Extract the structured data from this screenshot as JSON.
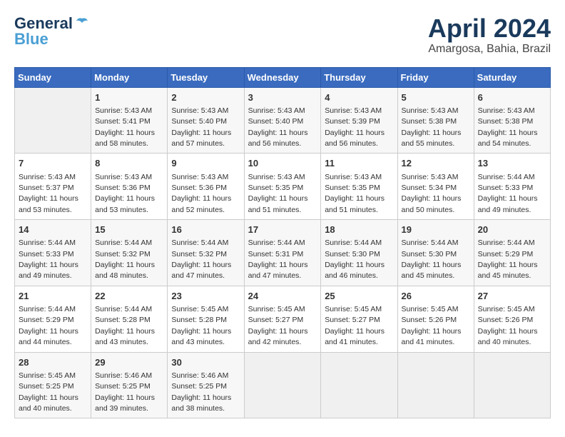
{
  "header": {
    "logo_line1": "General",
    "logo_line2": "Blue",
    "month": "April 2024",
    "location": "Amargosa, Bahia, Brazil"
  },
  "weekdays": [
    "Sunday",
    "Monday",
    "Tuesday",
    "Wednesday",
    "Thursday",
    "Friday",
    "Saturday"
  ],
  "weeks": [
    [
      {
        "day": "",
        "sunrise": "",
        "sunset": "",
        "daylight": ""
      },
      {
        "day": "1",
        "sunrise": "5:43 AM",
        "sunset": "5:41 PM",
        "daylight": "11 hours and 58 minutes."
      },
      {
        "day": "2",
        "sunrise": "5:43 AM",
        "sunset": "5:40 PM",
        "daylight": "11 hours and 57 minutes."
      },
      {
        "day": "3",
        "sunrise": "5:43 AM",
        "sunset": "5:40 PM",
        "daylight": "11 hours and 56 minutes."
      },
      {
        "day": "4",
        "sunrise": "5:43 AM",
        "sunset": "5:39 PM",
        "daylight": "11 hours and 56 minutes."
      },
      {
        "day": "5",
        "sunrise": "5:43 AM",
        "sunset": "5:38 PM",
        "daylight": "11 hours and 55 minutes."
      },
      {
        "day": "6",
        "sunrise": "5:43 AM",
        "sunset": "5:38 PM",
        "daylight": "11 hours and 54 minutes."
      }
    ],
    [
      {
        "day": "7",
        "sunrise": "5:43 AM",
        "sunset": "5:37 PM",
        "daylight": "11 hours and 53 minutes."
      },
      {
        "day": "8",
        "sunrise": "5:43 AM",
        "sunset": "5:36 PM",
        "daylight": "11 hours and 53 minutes."
      },
      {
        "day": "9",
        "sunrise": "5:43 AM",
        "sunset": "5:36 PM",
        "daylight": "11 hours and 52 minutes."
      },
      {
        "day": "10",
        "sunrise": "5:43 AM",
        "sunset": "5:35 PM",
        "daylight": "11 hours and 51 minutes."
      },
      {
        "day": "11",
        "sunrise": "5:43 AM",
        "sunset": "5:35 PM",
        "daylight": "11 hours and 51 minutes."
      },
      {
        "day": "12",
        "sunrise": "5:43 AM",
        "sunset": "5:34 PM",
        "daylight": "11 hours and 50 minutes."
      },
      {
        "day": "13",
        "sunrise": "5:44 AM",
        "sunset": "5:33 PM",
        "daylight": "11 hours and 49 minutes."
      }
    ],
    [
      {
        "day": "14",
        "sunrise": "5:44 AM",
        "sunset": "5:33 PM",
        "daylight": "11 hours and 49 minutes."
      },
      {
        "day": "15",
        "sunrise": "5:44 AM",
        "sunset": "5:32 PM",
        "daylight": "11 hours and 48 minutes."
      },
      {
        "day": "16",
        "sunrise": "5:44 AM",
        "sunset": "5:32 PM",
        "daylight": "11 hours and 47 minutes."
      },
      {
        "day": "17",
        "sunrise": "5:44 AM",
        "sunset": "5:31 PM",
        "daylight": "11 hours and 47 minutes."
      },
      {
        "day": "18",
        "sunrise": "5:44 AM",
        "sunset": "5:30 PM",
        "daylight": "11 hours and 46 minutes."
      },
      {
        "day": "19",
        "sunrise": "5:44 AM",
        "sunset": "5:30 PM",
        "daylight": "11 hours and 45 minutes."
      },
      {
        "day": "20",
        "sunrise": "5:44 AM",
        "sunset": "5:29 PM",
        "daylight": "11 hours and 45 minutes."
      }
    ],
    [
      {
        "day": "21",
        "sunrise": "5:44 AM",
        "sunset": "5:29 PM",
        "daylight": "11 hours and 44 minutes."
      },
      {
        "day": "22",
        "sunrise": "5:44 AM",
        "sunset": "5:28 PM",
        "daylight": "11 hours and 43 minutes."
      },
      {
        "day": "23",
        "sunrise": "5:45 AM",
        "sunset": "5:28 PM",
        "daylight": "11 hours and 43 minutes."
      },
      {
        "day": "24",
        "sunrise": "5:45 AM",
        "sunset": "5:27 PM",
        "daylight": "11 hours and 42 minutes."
      },
      {
        "day": "25",
        "sunrise": "5:45 AM",
        "sunset": "5:27 PM",
        "daylight": "11 hours and 41 minutes."
      },
      {
        "day": "26",
        "sunrise": "5:45 AM",
        "sunset": "5:26 PM",
        "daylight": "11 hours and 41 minutes."
      },
      {
        "day": "27",
        "sunrise": "5:45 AM",
        "sunset": "5:26 PM",
        "daylight": "11 hours and 40 minutes."
      }
    ],
    [
      {
        "day": "28",
        "sunrise": "5:45 AM",
        "sunset": "5:25 PM",
        "daylight": "11 hours and 40 minutes."
      },
      {
        "day": "29",
        "sunrise": "5:46 AM",
        "sunset": "5:25 PM",
        "daylight": "11 hours and 39 minutes."
      },
      {
        "day": "30",
        "sunrise": "5:46 AM",
        "sunset": "5:25 PM",
        "daylight": "11 hours and 38 minutes."
      },
      {
        "day": "",
        "sunrise": "",
        "sunset": "",
        "daylight": ""
      },
      {
        "day": "",
        "sunrise": "",
        "sunset": "",
        "daylight": ""
      },
      {
        "day": "",
        "sunrise": "",
        "sunset": "",
        "daylight": ""
      },
      {
        "day": "",
        "sunrise": "",
        "sunset": "",
        "daylight": ""
      }
    ]
  ]
}
